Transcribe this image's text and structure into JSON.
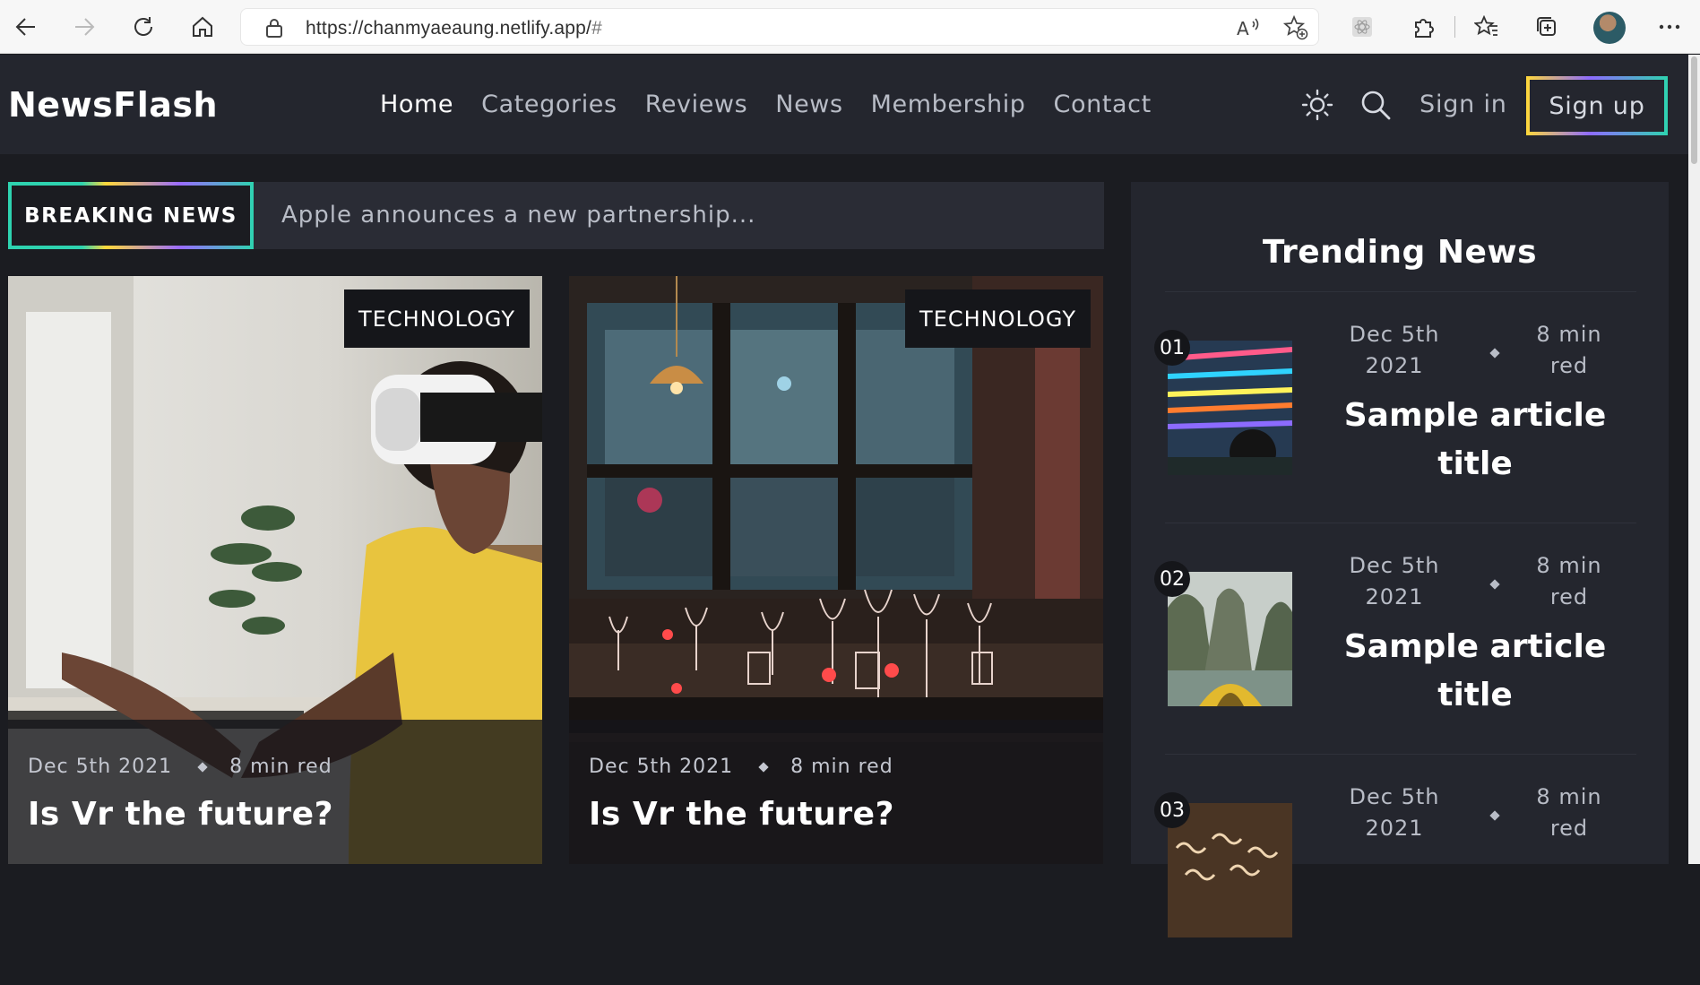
{
  "browser": {
    "url_host": "https://chanmyaeaung.netlify.app/",
    "url_hash": "#"
  },
  "site": {
    "brand": "NewsFlash",
    "nav": [
      {
        "label": "Home",
        "active": true
      },
      {
        "label": "Categories"
      },
      {
        "label": "Reviews"
      },
      {
        "label": "News"
      },
      {
        "label": "Membership"
      },
      {
        "label": "Contact"
      }
    ],
    "sign_in": "Sign in",
    "sign_up": "Sign up"
  },
  "breaking": {
    "badge": "BREAKING NEWS",
    "text": "Apple announces a new partnership..."
  },
  "cards": [
    {
      "category": "TECHNOLOGY",
      "date": "Dec 5th 2021",
      "read": "8 min red",
      "title": "Is Vr the future?"
    },
    {
      "category": "TECHNOLOGY",
      "date": "Dec 5th 2021",
      "read": "8 min red",
      "title": "Is Vr the future?"
    }
  ],
  "trending": {
    "title": "Trending News",
    "items": [
      {
        "num": "01",
        "date": "Dec 5th 2021",
        "read": "8 min red",
        "title": "Sample article title"
      },
      {
        "num": "02",
        "date": "Dec 5th 2021",
        "read": "8 min red",
        "title": "Sample article title"
      },
      {
        "num": "03",
        "date": "Dec 5th 2021",
        "read": "8 min red",
        "title": ""
      }
    ]
  },
  "colors": {
    "page_bg": "#1b1c21",
    "nav_bg": "#24262e",
    "accent_gradient": [
      "#ffd83a",
      "#8e6bff",
      "#2ed3b0"
    ]
  }
}
